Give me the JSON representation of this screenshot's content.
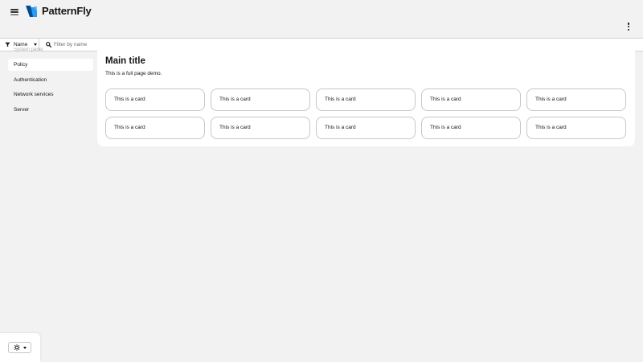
{
  "masthead": {
    "brand": "PatternFly",
    "logo_icon": "patternfly-logo",
    "menu_icon": "hamburger-icon",
    "actions_icon": "kebab-icon"
  },
  "toolbar": {
    "attribute_label": "Name",
    "attribute_icon": "filter-icon",
    "search_placeholder": "Filter by name",
    "search_value": ""
  },
  "sidebar": {
    "partially_hidden_item": "System panel",
    "items": [
      {
        "label": "Policy",
        "current": true
      },
      {
        "label": "Authentication",
        "current": false
      },
      {
        "label": "Network services",
        "current": false
      },
      {
        "label": "Server",
        "current": false
      }
    ]
  },
  "main": {
    "title": "Main title",
    "description": "This is a full page demo.",
    "cards": [
      "This is a card",
      "This is a card",
      "This is a card",
      "This is a card",
      "This is a card",
      "This is a card",
      "This is a card",
      "This is a card",
      "This is a card",
      "This is a card"
    ]
  },
  "theme_switcher": {
    "icon": "sun-icon"
  },
  "colors": {
    "page_background": "#f2f2f2",
    "surface": "#ffffff",
    "border": "#c7c7c7",
    "logo_blue": "#2b9af3"
  }
}
